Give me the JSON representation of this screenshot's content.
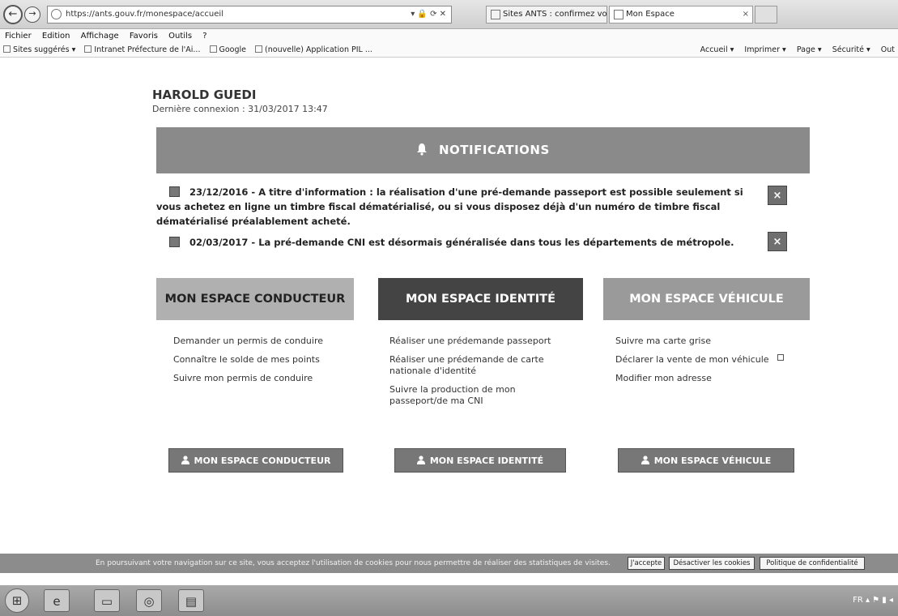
{
  "browser": {
    "address": "https://ants.gouv.fr/monespace/accueil",
    "tabs": [
      {
        "label": "Sites ANTS : confirmez votre c...",
        "icon": "site-icon"
      },
      {
        "label": "Mon Espace",
        "icon": "page-icon"
      }
    ],
    "menu": [
      "Fichier",
      "Edition",
      "Affichage",
      "Favoris",
      "Outils",
      "?"
    ],
    "favorites": [
      "Sites suggérés ▾",
      "Intranet Préfecture de l'Ai...",
      "Google",
      "(nouvelle) Application PIL ..."
    ],
    "commands": [
      "Accueil ▾",
      "Imprimer ▾",
      "Page ▾",
      "Sécurité ▾",
      "Out"
    ]
  },
  "user": {
    "name": "HAROLD GUEDI",
    "last_login": "Dernière connexion : 31/03/2017 13:47"
  },
  "notifications": {
    "title": "NOTIFICATIONS",
    "items": [
      {
        "text": "23/12/2016 - A titre d'information : la réalisation d'une pré-demande passeport est possible seulement si vous achetez en ligne un timbre fiscal dématérialisé, ou si vous disposez déjà d'un numéro de timbre fiscal dématérialisé préalablement acheté.",
        "close": "×"
      },
      {
        "text": "02/03/2017 - La pré-demande CNI est désormais généralisée dans tous les départements de métropole.",
        "close": "×"
      }
    ]
  },
  "spaces": {
    "conducteur": {
      "title": "MON ESPACE CONDUCTEUR",
      "links": [
        "Demander un permis de conduire",
        "Connaître le solde de mes points",
        "Suivre mon permis de conduire"
      ],
      "button": "MON ESPACE CONDUCTEUR"
    },
    "identite": {
      "title": "MON ESPACE IDENTITÉ",
      "links": [
        "Réaliser une prédemande passeport",
        "Réaliser une prédemande de carte nationale d'identité",
        "Suivre la production de mon passeport/de ma CNI"
      ],
      "button": "MON ESPACE IDENTITÉ"
    },
    "vehicule": {
      "title": "MON ESPACE VÉHICULE",
      "links": [
        "Suivre ma carte grise",
        "Déclarer la vente de mon véhicule",
        "Modifier mon adresse"
      ],
      "button": "MON ESPACE VÉHICULE"
    }
  },
  "cookies": {
    "message": "En poursuivant votre navigation sur ce site, vous acceptez l'utilisation de cookies pour nous permettre de réaliser des statistiques de visites.",
    "accept": "J'accepte",
    "disable": "Désactiver les cookies",
    "policy": "Politique de confidentialité"
  },
  "taskbar": {
    "tray": "FR"
  },
  "colors": {
    "banner": "#8a8a8a",
    "identite": "#444444",
    "conducteur": "#b0b0b0",
    "vehicule": "#9a9a9a"
  }
}
